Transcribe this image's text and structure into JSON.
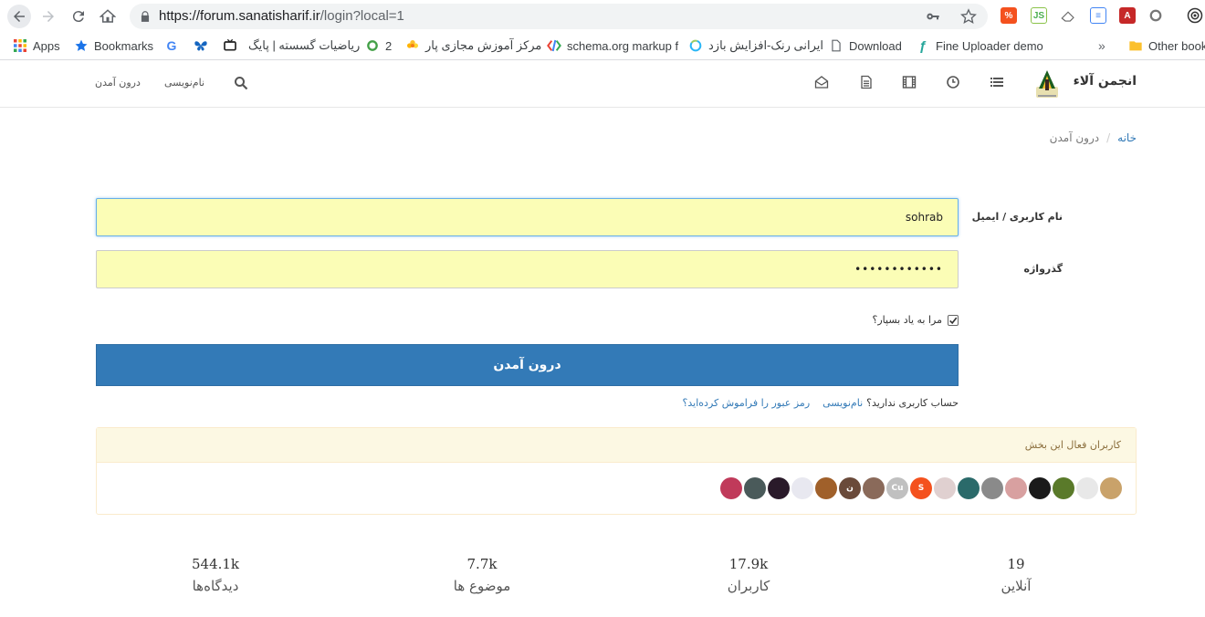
{
  "browser": {
    "url_host": "https://forum.sanatisharif.ir",
    "url_path": "/login?local=1"
  },
  "bookmarks": {
    "items": [
      {
        "label": "Apps",
        "icon": "apps-grid-icon"
      },
      {
        "label": "Bookmarks",
        "icon": "star-icon"
      },
      {
        "label": "",
        "icon": "google-icon"
      },
      {
        "label": "",
        "icon": "butterfly-icon"
      },
      {
        "label": "",
        "icon": "tv-icon"
      },
      {
        "label": "ریاضیات گسسته | پایگ",
        "icon": "page-icon"
      },
      {
        "label": "2",
        "icon": "refresh-green-icon"
      },
      {
        "label": "مرکز آموزش مجازی پار",
        "icon": "flower-icon"
      },
      {
        "label": "schema.org markup f",
        "icon": "schema-icon"
      },
      {
        "label": "ایرانی رنک-افزایش بازد",
        "icon": "circle-loader-icon"
      },
      {
        "label": "Download",
        "icon": "page-icon"
      },
      {
        "label": "Fine Uploader demo",
        "icon": "fineuploader-icon"
      },
      {
        "label": "Other bookm",
        "icon": "folder-icon"
      }
    ],
    "overflow": "»"
  },
  "navbar": {
    "brand": "انجمن آلاء",
    "register": "نام‌نویسی",
    "login": "درون آمدن"
  },
  "breadcrumb": {
    "home": "خانه",
    "separator": "/",
    "current": "درون آمدن"
  },
  "form": {
    "username_label": "نام کاربری / ایمیل",
    "username_value": "sohrab",
    "password_label": "گذرواژه",
    "password_value": "••••••••••••",
    "remember_label": "مرا به یاد بسپار؟",
    "remember_checked": true,
    "submit_label": "درون آمدن",
    "no_account_q": "حساب کاربری ندارید؟",
    "register_link": "نام‌نویسی",
    "forgot_link": "رمز عبور را فراموش کرده‌اید؟"
  },
  "active_users": {
    "title": "کاربران فعال این بخش",
    "avatars": [
      {
        "color": "#c9a26a",
        "letter": ""
      },
      {
        "color": "#e8e8e8",
        "letter": ""
      },
      {
        "color": "#5a7a2a",
        "letter": ""
      },
      {
        "color": "#1a1a1a",
        "letter": ""
      },
      {
        "color": "#d8a0a0",
        "letter": ""
      },
      {
        "color": "#8a8a8a",
        "letter": ""
      },
      {
        "color": "#2a6a6a",
        "letter": ""
      },
      {
        "color": "#e0d0d0",
        "letter": ""
      },
      {
        "color": "#f4511e",
        "letter": "S"
      },
      {
        "color": "#c0c0c0",
        "letter": "Cu"
      },
      {
        "color": "#8a6a5a",
        "letter": ""
      },
      {
        "color": "#6a4a3a",
        "letter": "ن"
      },
      {
        "color": "#a0602a",
        "letter": ""
      },
      {
        "color": "#e8e8f0",
        "letter": ""
      },
      {
        "color": "#2a1a2a",
        "letter": ""
      },
      {
        "color": "#4a5a5a",
        "letter": ""
      },
      {
        "color": "#c03a5a",
        "letter": ""
      }
    ]
  },
  "stats": [
    {
      "value": "19",
      "label": "آنلاین"
    },
    {
      "value": "17.9k",
      "label": "کاربران"
    },
    {
      "value": "7.7k",
      "label": "موضوع ها"
    },
    {
      "value": "544.1k",
      "label": "دیدگاه‌ها"
    }
  ],
  "colors": {
    "primary": "#337ab7",
    "autofill": "#fbfdb6",
    "panel_header": "#fcf8e3",
    "panel_text": "#8a6d3b"
  }
}
